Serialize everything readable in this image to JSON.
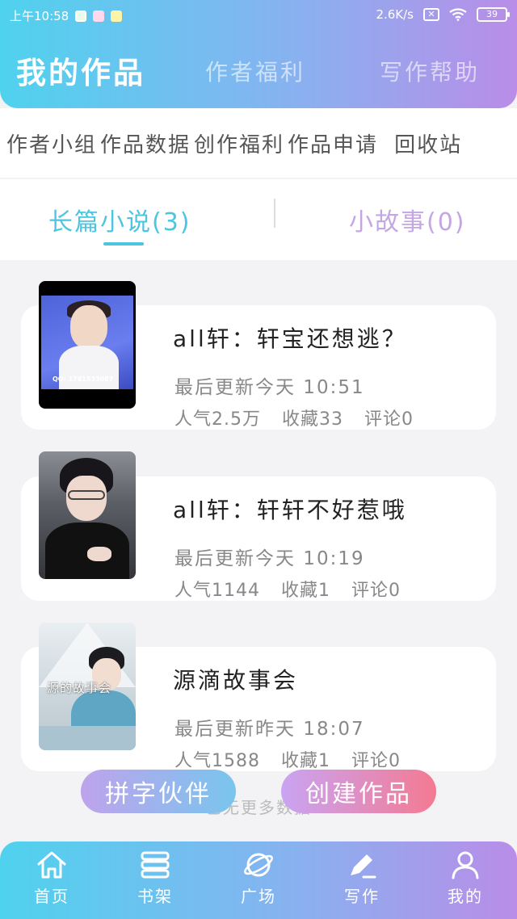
{
  "status_bar": {
    "time": "上午10:58",
    "net_speed": "2.6K/s",
    "battery": "39",
    "icons": [
      "app-notification-icon",
      "app-notification-icon",
      "app-notification-icon",
      "no-sim-icon",
      "wifi-icon",
      "battery-icon"
    ]
  },
  "header": {
    "tabs": [
      {
        "label": "我的作品",
        "active": true
      },
      {
        "label": "作者福利",
        "active": false
      },
      {
        "label": "写作帮助",
        "active": false
      }
    ]
  },
  "quick_links": [
    "作者小组",
    "作品数据",
    "创作福利",
    "作品申请",
    "回收站"
  ],
  "sub_tabs": {
    "long": "长篇小说(3)",
    "short": "小故事(0)",
    "active": "long"
  },
  "works": [
    {
      "title": "all轩：轩宝还想逃？",
      "updated": "最后更新今天 10:51",
      "popularity": "人气2.5万",
      "favorites": "收藏33",
      "comments": "评论0",
      "cover_text": "QQ: 1781533087"
    },
    {
      "title": "all轩：轩轩不好惹哦",
      "updated": "最后更新今天 10:19",
      "popularity": "人气1144",
      "favorites": "收藏1",
      "comments": "评论0"
    },
    {
      "title": "源滴故事会",
      "updated": "最后更新昨天 18:07",
      "popularity": "人气1588",
      "favorites": "收藏1",
      "comments": "评论0",
      "cover_text": "源的故事会"
    }
  ],
  "floating_buttons": {
    "partner": "拼字伙伴",
    "create": "创建作品"
  },
  "list_footer": "已无更多数据",
  "bottom_nav": [
    {
      "label": "首页",
      "icon": "home-icon"
    },
    {
      "label": "书架",
      "icon": "bookshelf-icon"
    },
    {
      "label": "广场",
      "icon": "planet-icon"
    },
    {
      "label": "写作",
      "icon": "write-icon",
      "active": true
    },
    {
      "label": "我的",
      "icon": "profile-icon"
    }
  ],
  "colors": {
    "gradient_start": "#4fd2ee",
    "gradient_end": "#b98de8",
    "active_subtab": "#4cc5e0",
    "inactive_subtab": "#c3a6e3",
    "create_button_end": "#f47a92"
  }
}
